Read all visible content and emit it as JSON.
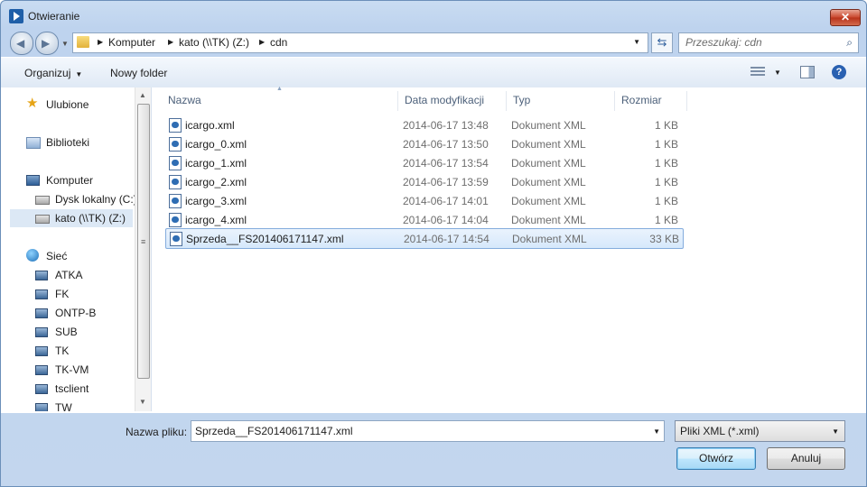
{
  "window": {
    "title": "Otwieranie",
    "close": "✕"
  },
  "address": {
    "crumbs": [
      "Komputer",
      "kato (\\\\TK) (Z:)",
      "cdn"
    ]
  },
  "search": {
    "placeholder": "Przeszukaj: cdn"
  },
  "toolbar": {
    "organize": "Organizuj",
    "new_folder": "Nowy folder",
    "help": "?"
  },
  "sidebar": {
    "favorites": "Ulubione",
    "libraries": "Biblioteki",
    "computer": "Komputer",
    "drives": [
      "Dysk lokalny (C:)",
      "kato (\\\\TK) (Z:)"
    ],
    "network": "Sieć",
    "network_items": [
      "ATKA",
      "FK",
      "ONTP-B",
      "SUB",
      "TK",
      "TK-VM",
      "tsclient",
      "TW"
    ]
  },
  "columns": {
    "name": "Nazwa",
    "date": "Data modyfikacji",
    "type": "Typ",
    "size": "Rozmiar"
  },
  "files": [
    {
      "name": "icargo.xml",
      "date": "2014-06-17 13:48",
      "type": "Dokument XML",
      "size": "1 KB"
    },
    {
      "name": "icargo_0.xml",
      "date": "2014-06-17 13:50",
      "type": "Dokument XML",
      "size": "1 KB"
    },
    {
      "name": "icargo_1.xml",
      "date": "2014-06-17 13:54",
      "type": "Dokument XML",
      "size": "1 KB"
    },
    {
      "name": "icargo_2.xml",
      "date": "2014-06-17 13:59",
      "type": "Dokument XML",
      "size": "1 KB"
    },
    {
      "name": "icargo_3.xml",
      "date": "2014-06-17 14:01",
      "type": "Dokument XML",
      "size": "1 KB"
    },
    {
      "name": "icargo_4.xml",
      "date": "2014-06-17 14:04",
      "type": "Dokument XML",
      "size": "1 KB"
    },
    {
      "name": "Sprzeda__FS201406171147.xml",
      "date": "2014-06-17 14:54",
      "type": "Dokument XML",
      "size": "33 KB"
    }
  ],
  "footer": {
    "filename_label": "Nazwa pliku:",
    "filename_value": "Sprzeda__FS201406171147.xml",
    "filter_value": "Pliki XML (*.xml)",
    "open_label": "Otwórz",
    "cancel_label": "Anuluj"
  },
  "colors": {
    "accent": "#2a61b1",
    "selection": "#d6e8fb",
    "close": "#c9462c"
  }
}
